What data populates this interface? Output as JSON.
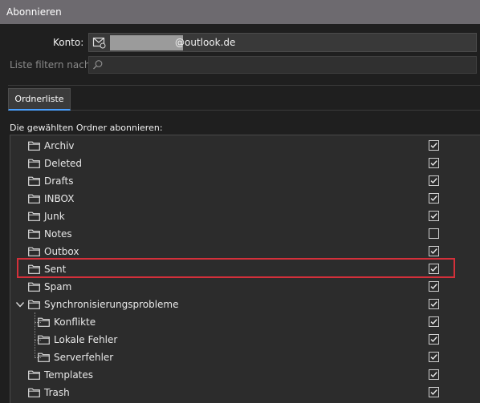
{
  "window": {
    "title": "Abonnieren"
  },
  "account": {
    "label": "Konto:",
    "email_suffix": "@outlook.de",
    "icon": "mail-account-icon"
  },
  "filter": {
    "label": "Liste filtern nach:",
    "value": "",
    "icon": "search-icon"
  },
  "tabs": [
    {
      "label": "Ordnerliste",
      "active": true
    }
  ],
  "instruction": "Die gewählten Ordner abonnieren:",
  "colors": {
    "highlight": "#d4303a",
    "tab_accent": "#4aa0ff"
  },
  "folders": [
    {
      "name": "Archiv",
      "checked": true,
      "level": 0
    },
    {
      "name": "Deleted",
      "checked": true,
      "level": 0
    },
    {
      "name": "Drafts",
      "checked": true,
      "level": 0
    },
    {
      "name": "INBOX",
      "checked": true,
      "level": 0
    },
    {
      "name": "Junk",
      "checked": true,
      "level": 0
    },
    {
      "name": "Notes",
      "checked": false,
      "level": 0
    },
    {
      "name": "Outbox",
      "checked": true,
      "level": 0
    },
    {
      "name": "Sent",
      "checked": true,
      "level": 0,
      "highlighted": true
    },
    {
      "name": "Spam",
      "checked": true,
      "level": 0
    },
    {
      "name": "Synchronisierungsprobleme",
      "checked": true,
      "level": 0,
      "expanded": true
    },
    {
      "name": "Konflikte",
      "checked": true,
      "level": 1
    },
    {
      "name": "Lokale Fehler",
      "checked": true,
      "level": 1
    },
    {
      "name": "Serverfehler",
      "checked": true,
      "level": 1
    },
    {
      "name": "Templates",
      "checked": true,
      "level": 0
    },
    {
      "name": "Trash",
      "checked": true,
      "level": 0
    }
  ]
}
